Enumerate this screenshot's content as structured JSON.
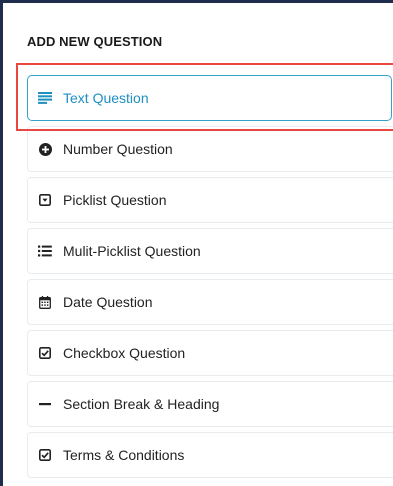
{
  "panel": {
    "heading": "ADD NEW QUESTION"
  },
  "colors": {
    "accent": "#1e8fc2",
    "active_border": "#31a3c9",
    "highlight": "#e8483f",
    "frame": "#1f2d4d",
    "item_border": "#e9ecef"
  },
  "question_types": [
    {
      "label": "Text Question",
      "icon": "text-lines-icon",
      "active": true
    },
    {
      "label": "Number Question",
      "icon": "plus-circle-icon",
      "active": false
    },
    {
      "label": "Picklist Question",
      "icon": "dropdown-box-icon",
      "active": false
    },
    {
      "label": "Mulit-Picklist Question",
      "icon": "list-icon",
      "active": false
    },
    {
      "label": "Date Question",
      "icon": "calendar-icon",
      "active": false
    },
    {
      "label": "Checkbox Question",
      "icon": "checkbox-icon",
      "active": false
    },
    {
      "label": "Section Break & Heading",
      "icon": "minus-icon",
      "active": false
    },
    {
      "label": "Terms & Conditions",
      "icon": "checkbox-icon",
      "active": false
    }
  ]
}
